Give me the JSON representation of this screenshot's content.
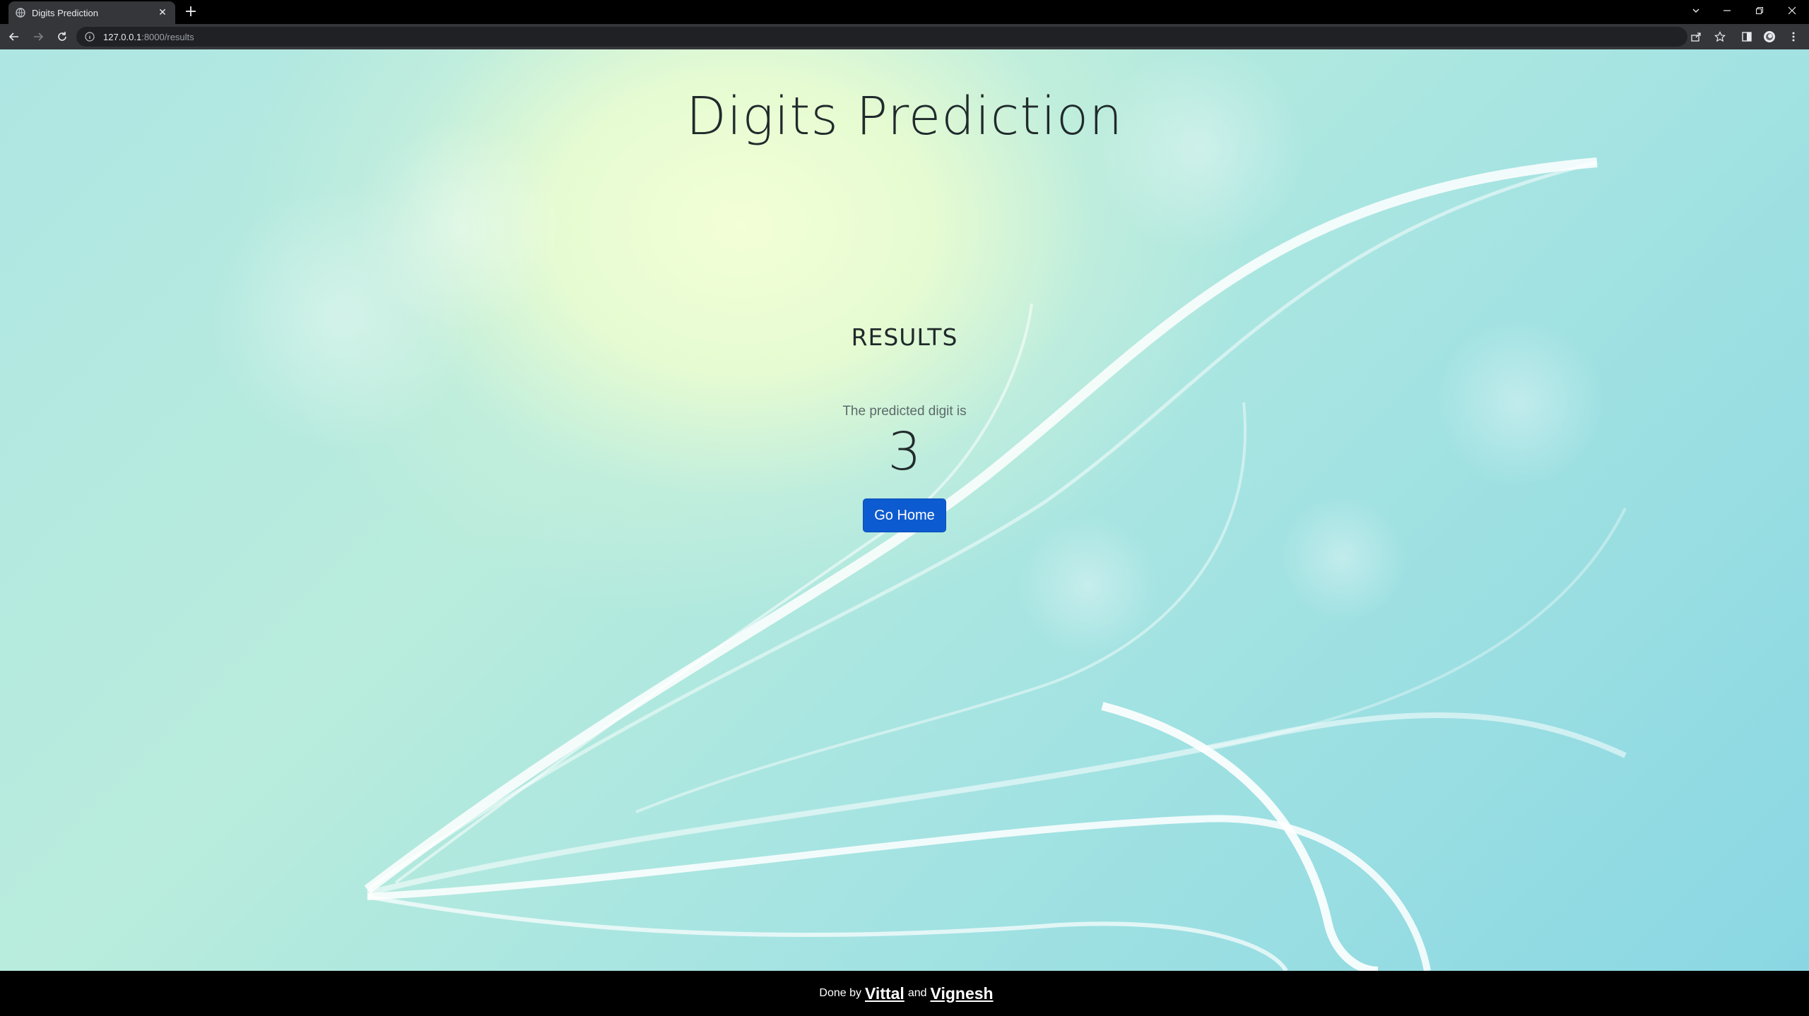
{
  "browser": {
    "tab_title": "Digits Prediction",
    "new_tab_label": "+",
    "url_host": "127.0.0.1",
    "url_path": ":8000/results"
  },
  "page": {
    "title": "Digits Prediction",
    "results_heading": "RESULTS",
    "predicted_label": "The predicted digit is",
    "predicted_digit": "3",
    "go_home_label": "Go Home"
  },
  "footer": {
    "prefix": "Done by",
    "author1": "Vittal",
    "connector": "and",
    "author2": "Vignesh"
  },
  "colors": {
    "button": "#0d5bd0",
    "footer_bg": "#000000",
    "chrome_toolbar": "#35363a"
  }
}
